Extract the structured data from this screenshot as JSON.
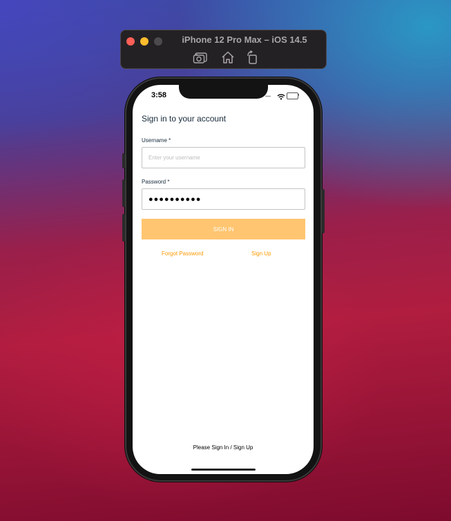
{
  "simulator": {
    "title": "iPhone 12 Pro Max – iOS 14.5",
    "toolbar": [
      "screenshot-icon",
      "home-icon",
      "rotate-icon"
    ]
  },
  "status_bar": {
    "time": "3:58",
    "signal_dots": "••••"
  },
  "form": {
    "title": "Sign in to your account",
    "username_label": "Username *",
    "username_placeholder": "Enter your username",
    "password_label": "Password *",
    "password_value": "●●●●●●●●●●",
    "signin_label": "SIGN IN",
    "forgot_password": "Forgot Password",
    "sign_up": "Sign Up"
  },
  "footer": {
    "text": "Please Sign In / Sign Up"
  },
  "colors": {
    "accent": "#ff9900",
    "button": "#ffc570",
    "text": "#152939"
  }
}
